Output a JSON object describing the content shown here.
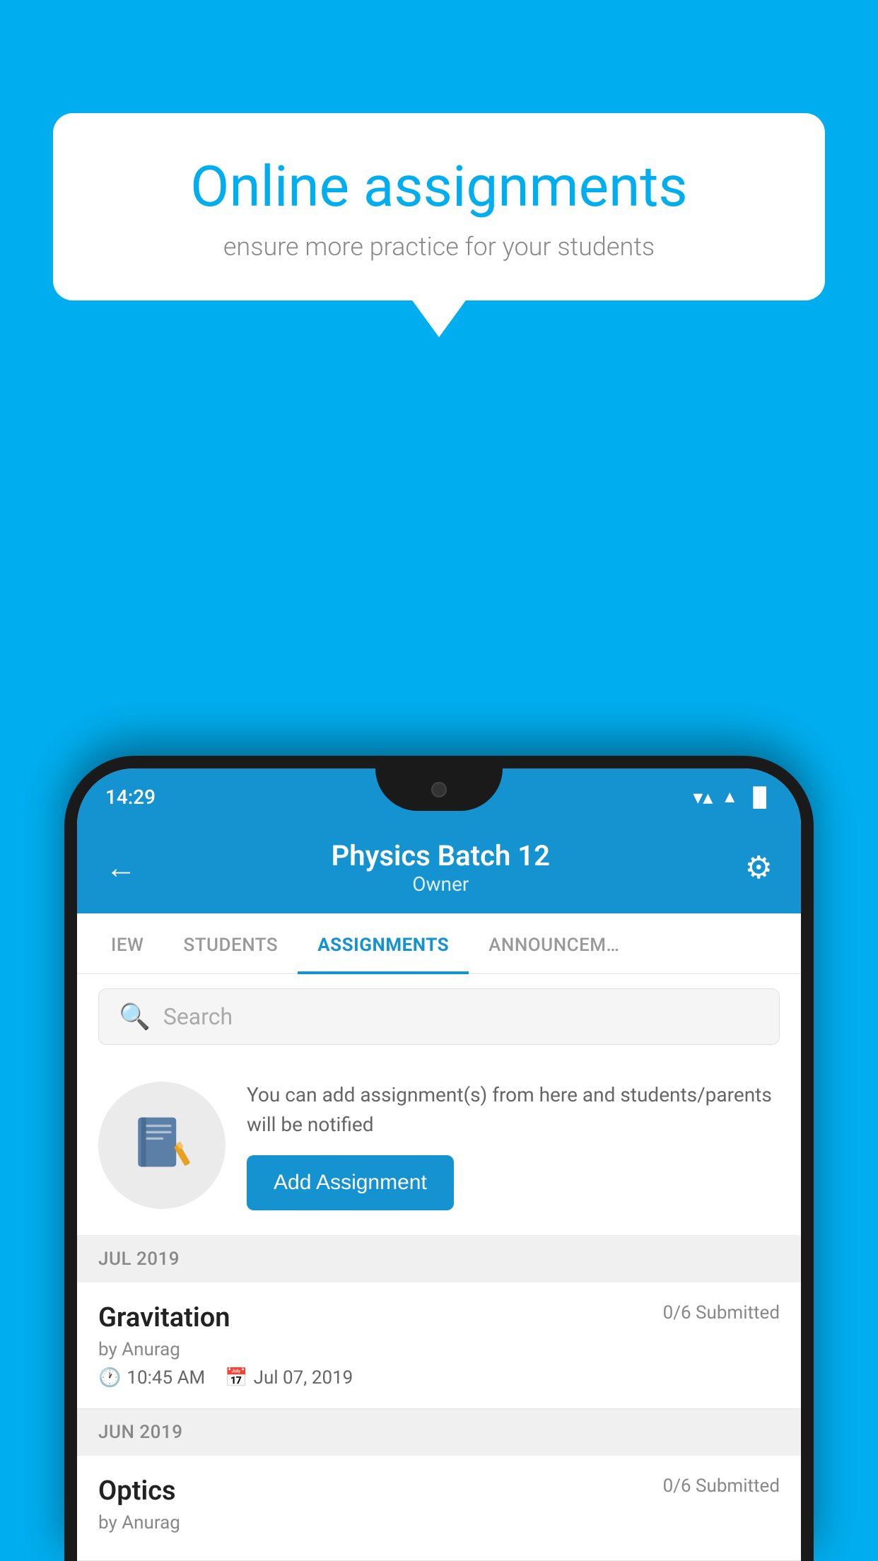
{
  "background_color": "#00AEEF",
  "speech_bubble": {
    "title": "Online assignments",
    "subtitle": "ensure more practice for your students"
  },
  "phone": {
    "status_bar": {
      "time": "14:29",
      "wifi": "▼",
      "signal": "▲",
      "battery": "▐"
    },
    "header": {
      "back_label": "←",
      "title": "Physics Batch 12",
      "subtitle": "Owner",
      "settings_label": "⚙"
    },
    "tabs": [
      {
        "label": "IEW",
        "active": false
      },
      {
        "label": "STUDENTS",
        "active": false
      },
      {
        "label": "ASSIGNMENTS",
        "active": true
      },
      {
        "label": "ANNOUNCEM…",
        "active": false
      }
    ],
    "search": {
      "placeholder": "Search"
    },
    "info_card": {
      "message": "You can add assignment(s) from here and students/parents will be notified",
      "button_label": "Add Assignment"
    },
    "sections": [
      {
        "header": "JUL 2019",
        "items": [
          {
            "name": "Gravitation",
            "status": "0/6 Submitted",
            "author": "by Anurag",
            "time": "10:45 AM",
            "date": "Jul 07, 2019"
          }
        ]
      },
      {
        "header": "JUN 2019",
        "items": [
          {
            "name": "Optics",
            "status": "0/6 Submitted",
            "author": "by Anurag",
            "time": "",
            "date": ""
          }
        ]
      }
    ]
  }
}
